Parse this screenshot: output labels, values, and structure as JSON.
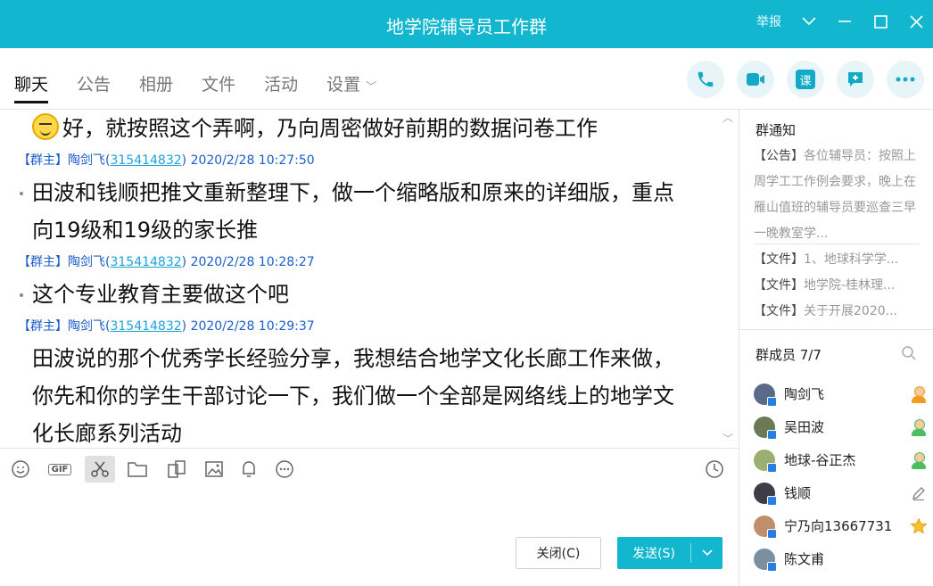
{
  "window": {
    "title": "地学院辅导员工作群",
    "report": "举报"
  },
  "tabs": [
    {
      "label": "聊天"
    },
    {
      "label": "公告"
    },
    {
      "label": "相册"
    },
    {
      "label": "文件"
    },
    {
      "label": "活动"
    },
    {
      "label": "设置"
    }
  ],
  "actions": {
    "lesson": "课"
  },
  "messages": {
    "m0": {
      "text": "好，就按照这个弄啊，乃向周密做好前期的数据问卷工作"
    },
    "m1": {
      "role": "【群主】",
      "name": "陶剑飞(",
      "qq": "315414832",
      "close": ")",
      "time": "2020/2/28 10:27:50",
      "line1": "田波和钱顺把推文重新整理下，做一个缩略版和原来的详细版，重点",
      "line2": "向19级和19级的家长推"
    },
    "m2": {
      "role": "【群主】",
      "name": "陶剑飞(",
      "qq": "315414832",
      "close": ")",
      "time": "2020/2/28 10:28:27",
      "line1": "这个专业教育主要做这个吧"
    },
    "m3": {
      "role": "【群主】",
      "name": "陶剑飞(",
      "qq": "315414832",
      "close": ")",
      "time": "2020/2/28 10:29:37",
      "line1": "田波说的那个优秀学长经验分享，我想结合地学文化长廊工作来做，",
      "line2": "你先和你的学生干部讨论一下，我们做一个全部是网络线上的地学文",
      "line3": "化长廊系列活动"
    }
  },
  "toolbar": {
    "gif": "GIF"
  },
  "buttons": {
    "close": "关闭(C)",
    "send": "发送(S)"
  },
  "side": {
    "notice_title": "群通知",
    "notice_tag": "【公告】",
    "notice_text": "各位辅导员：按照上周学工工作例会要求，晚上在雁山值班的辅导员要巡查三早一晚教室学...",
    "files": [
      {
        "tag": "【文件】",
        "name": "1、地球科学学..."
      },
      {
        "tag": "【文件】",
        "name": "地学院-桂林理..."
      },
      {
        "tag": "【文件】",
        "name": "关于开展2020..."
      }
    ],
    "members_title": "群成员 7/7",
    "members": [
      {
        "name": "陶剑飞",
        "avatar_color": "#5a6b8a"
      },
      {
        "name": "吴田波",
        "avatar_color": "#6b7a55"
      },
      {
        "name": "地球-谷正杰",
        "avatar_color": "#9bb070"
      },
      {
        "name": "钱顺",
        "avatar_color": "#3d3d4a"
      },
      {
        "name": "宁乃向13667731",
        "avatar_color": "#c28d6a"
      },
      {
        "name": "陈文甫",
        "avatar_color": "#7a8fa0"
      }
    ]
  },
  "colors": {
    "accent": "#12b7cf",
    "link": "#1ca3d9"
  }
}
